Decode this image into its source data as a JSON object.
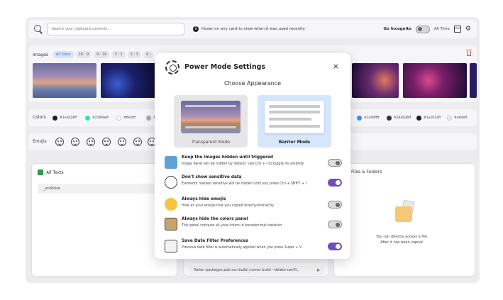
{
  "topbar": {
    "search_placeholder": "Search your clipboard contents ...",
    "hint": "Hover on any card to view when it was used recently",
    "incognito_label": "Go Incognito",
    "time_filter": "All Time"
  },
  "images": {
    "label": "Images",
    "filters": [
      "All Sizes",
      "16 : 9",
      "9 : 16",
      "3 : 2",
      "3 : 3",
      "4 :"
    ]
  },
  "colors": {
    "label": "Colors",
    "items_left": [
      {
        "hex": "#1e2024ff",
        "swatch": "#1e2024"
      },
      {
        "hex": "#21f09eff",
        "swatch": "#21f09e"
      },
      {
        "hex": "#ffef4ff",
        "swatch": "#ffffff"
      },
      {
        "hex": "#",
        "swatch": "#aaaaaa"
      }
    ],
    "items_right": [
      {
        "hex": "#3394ffff",
        "swatch": "#3394ff"
      },
      {
        "hex": "#363636ff",
        "swatch": "#363636"
      },
      {
        "hex": "#1e2023ff",
        "swatch": "#1e2023"
      },
      {
        "hex": "#efefeff",
        "swatch": "#efefef"
      }
    ]
  },
  "emojis": {
    "label": "Emojis",
    "count": 7
  },
  "all_texts": {
    "title": "All Texts",
    "rows": [
      "_endDate"
    ]
  },
  "middle_texts": {
    "rows": [
      "",
      "flutter packages pub run build_runner build --delete-confli..."
    ]
  },
  "files": {
    "title": "Files & Folders",
    "note_line1": "You can directly access a file",
    "note_line2": "After it has been copied"
  },
  "modal": {
    "title": "Power Mode Settings",
    "close": "×",
    "subtitle": "Choose Appearance",
    "mode_transparent": "Transparent Mode",
    "mode_barrier": "Barrier Mode",
    "settings": [
      {
        "title": "Keep the images hidden until triggered",
        "desc": "Image Panel will be hidden by default, Use Ctrl + I to toggle its visibility",
        "on": false
      },
      {
        "title": "Don't show sensitive data",
        "desc": "Elements marked sensitive will be hidden until you press Ctrl + SHIFT + I",
        "on": true
      },
      {
        "title": "Always hide emojis",
        "desc": "Hide all your emojis that you copied directly/indirectly",
        "on": false
      },
      {
        "title": "Always hide the colors panel",
        "desc": "This panel contains all your colors in hexadecimal notation",
        "on": false
      },
      {
        "title": "Save Date Filter Preferences",
        "desc": "Previous date filter is automatically applied when you press Super + V",
        "on": true
      }
    ]
  },
  "colors_theme": {
    "accent": "#6a4fc0",
    "delete": "#e05050",
    "green": "#2e9b4a"
  }
}
